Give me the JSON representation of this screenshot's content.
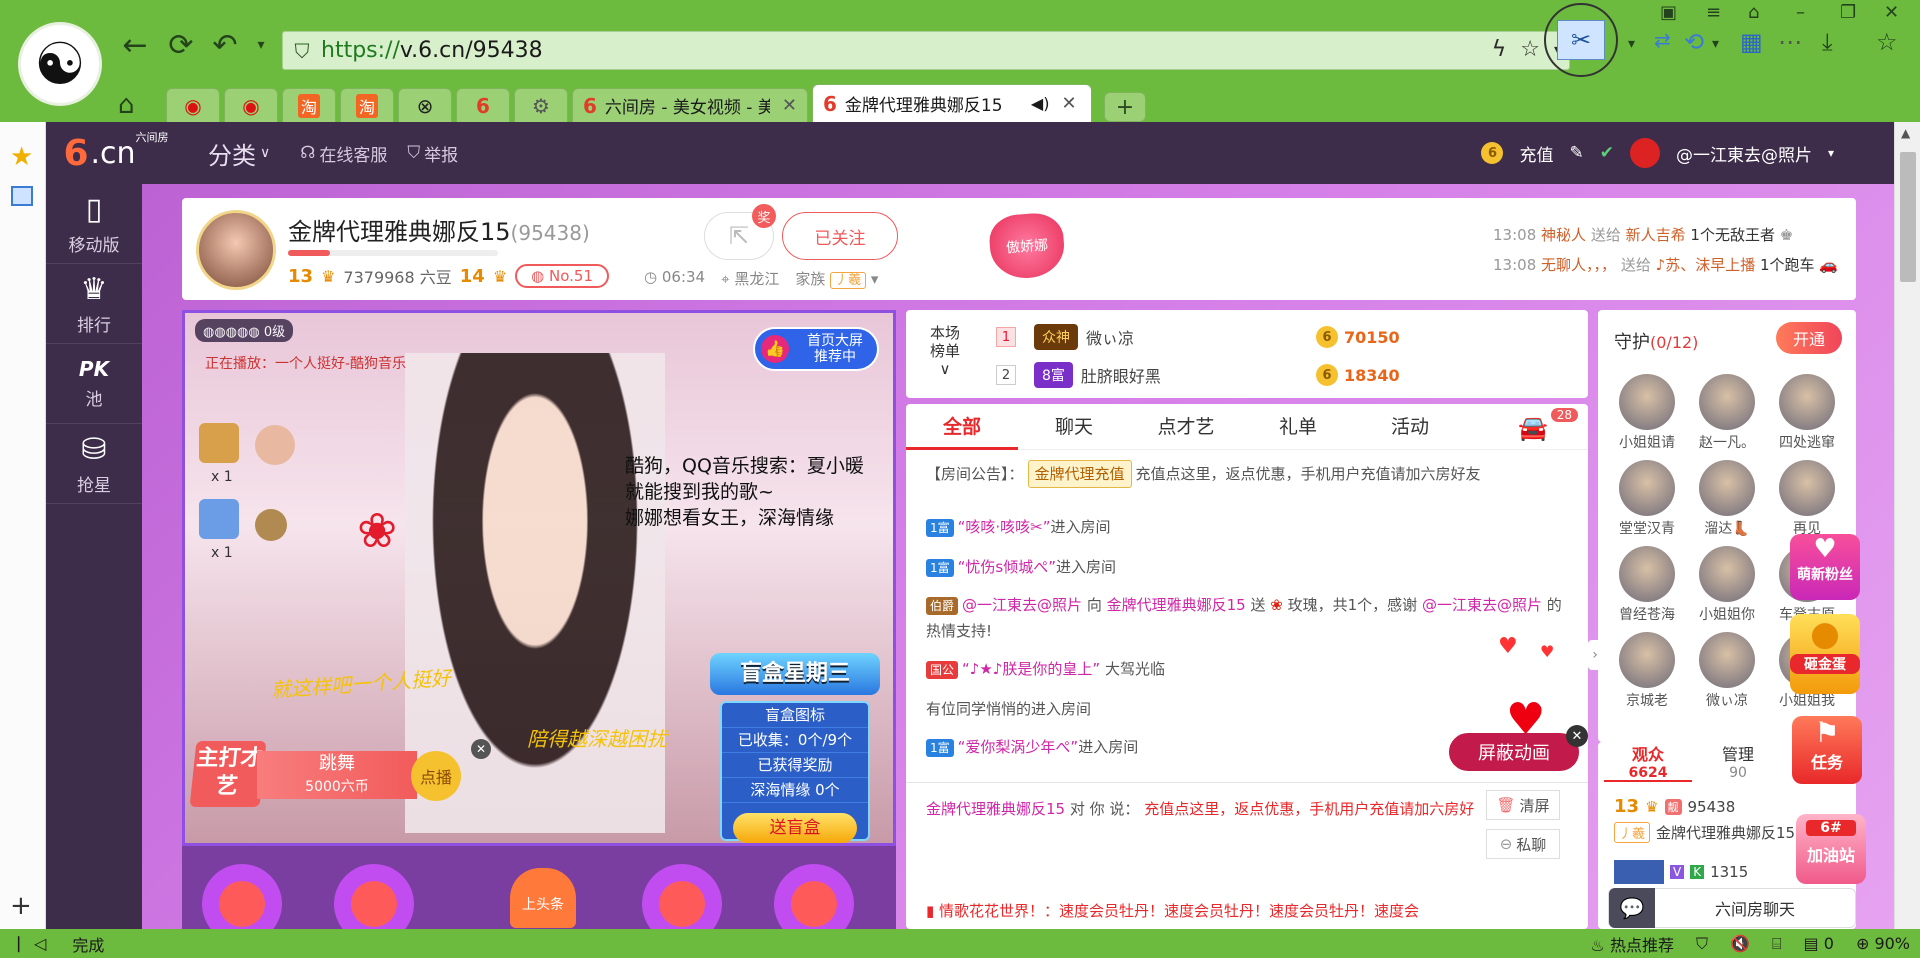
{
  "browser": {
    "url_scheme": "https://",
    "url_host": "v.6.cn",
    "url_path": "/95438",
    "tabs": [
      {
        "label": "六间房 - 美女视频 - 美女"
      },
      {
        "label": "金牌代理雅典娜反15"
      }
    ],
    "new_tab": "+",
    "status_text": "完成",
    "status_hot": "热点推荐",
    "status_count": "0",
    "zoom": "90%"
  },
  "site": {
    "logo_main": "6",
    "logo_tld": ".cn",
    "logo_small": "六间房",
    "category": "分类",
    "service": "在线客服",
    "report": "举报",
    "recharge": "充值",
    "user": "@一江東去@照片"
  },
  "leftnav": [
    {
      "label": "移动版",
      "icon": "mobile-icon"
    },
    {
      "label": "排行",
      "icon": "crown-icon"
    },
    {
      "label": "池",
      "icon": "pk-icon",
      "prefix": "PK"
    },
    {
      "label": "抢星",
      "icon": "basket-icon"
    }
  ],
  "anchor": {
    "name": "金牌代理雅典娜反15",
    "room_id": "(95438)",
    "level_left": "13",
    "beans": "7379968 六豆",
    "level_right": "14",
    "rank": "No.51",
    "award": "奖",
    "follow": "已关注",
    "time": "06:34",
    "location": "黑龙江",
    "family_label": "家族",
    "family_badge": "丿羲",
    "heart_label": "傲娇娜",
    "notices": [
      {
        "time": "13:08",
        "from": "神秘人",
        "verb": "送给",
        "to": "新人吉希",
        "item": "1个无敌王者"
      },
      {
        "time": "13:08",
        "from": "无聊人，，，",
        "verb": "送给",
        "to": "♪苏、沫早上播",
        "item": "1个跑车"
      }
    ]
  },
  "video": {
    "level_text": "0级",
    "now_playing": "正在播放：一个人挺好-酷狗音乐",
    "recommend_line1": "首页大屏",
    "recommend_line2": "推荐中",
    "overlay_text": [
      "酷狗，QQ音乐搜索：夏小暖",
      "就能搜到我的歌~",
      "娜娜想看女王，深海情缘"
    ],
    "gift_count_1": "x 1",
    "gift_count_2": "x 1",
    "lyric_1": "就这样吧一个人挺好",
    "lyric_2": "陪得越深越困扰",
    "talent_tag": "主打才艺",
    "talent_name": "跳舞",
    "talent_price": "5000六币",
    "talent_request": "点播",
    "blindbox_title": "盲盒星期三",
    "blindbox_rows": [
      "盲盒图标",
      "已收集：0个/9个",
      "已获得奖励",
      "深海情缘 0个"
    ],
    "blindbox_send": "送盲盒"
  },
  "bottom_bar": {
    "headline": "上头条"
  },
  "rank": {
    "title_1": "本场",
    "title_2": "榜单",
    "rows": [
      {
        "num": "1",
        "badge": "众神",
        "name": "微ぃ凉",
        "value": "70150"
      },
      {
        "num": "2",
        "badge": "8富",
        "name": "肚脐眼好黑",
        "value": "18340"
      }
    ]
  },
  "chat": {
    "tabs": [
      "全部",
      "聊天",
      "点才艺",
      "礼单",
      "活动"
    ],
    "car_count": "28",
    "announcement_label": "【房间公告】：",
    "announcement_tag": "金牌代理充值",
    "announcement_text": "充值点这里，返点优惠，手机用户充值请加六房好友",
    "lines": [
      {
        "chip": "1富",
        "name": "“咳咳·咳咳✂”",
        "text": "进入房间"
      },
      {
        "chip": "1富",
        "name": "“忧伤s倾城ぺ”",
        "text": "进入房间"
      }
    ],
    "gift_chip": "伯爵",
    "gift_from": "@一江東去@照片",
    "gift_verb": "向",
    "gift_to": "金牌代理雅典娜反15",
    "gift_send": "送",
    "gift_tail": "玫瑰，共1个，感谢",
    "gift_thanks": "@一江東去@照片",
    "gift_end": "的热情支持!",
    "royal_chip": "国公",
    "royal_name": "“♪★♪朕是你的皇上”",
    "royal_text": "大驾光临",
    "quiet_text": "有位同学悄悄的进入房间",
    "last_chip": "1富",
    "last_name": "“爱你梨涡少年ぺ”",
    "last_text": "进入房间",
    "mute_anim": "屏蔽动画",
    "clear": "清屏",
    "private": "私聊",
    "said_from": "金牌代理雅典娜反15",
    "said_to": "对 你 说：",
    "said_text": "充值点这里，返点优惠，手机用户充值请加六房好",
    "ticker": "情歌花花世界！：速度会员牡丹！速度会员牡丹！速度会员牡丹！速度会"
  },
  "guard": {
    "title": "守护",
    "count": "(0/12)",
    "open": "开通",
    "members": [
      "小姐姐请",
      "赵一凡。",
      "四处逃窜",
      "堂堂汉青",
      "溜达👢",
      "再见",
      "曾经苍海",
      "小姐姐你",
      "车登古原",
      "京城老",
      "微ぃ凉",
      "小姐姐我"
    ]
  },
  "audience": {
    "tab1": "观众",
    "tab1_count": "6624",
    "tab2": "管理",
    "tab2_count": "90",
    "row1_level": "13",
    "row1_id": "95438",
    "row1_family": "丿羲",
    "row1_name": "金牌代理雅典娜反15",
    "row2_num": "1315",
    "row2_tag": "无忧",
    "chatbar": "六间房聊天"
  },
  "floats": {
    "fans": "萌新粉丝",
    "egg": "砸金蛋",
    "task": "任务",
    "fuel": "加油站",
    "fuel_tag": "6#"
  }
}
